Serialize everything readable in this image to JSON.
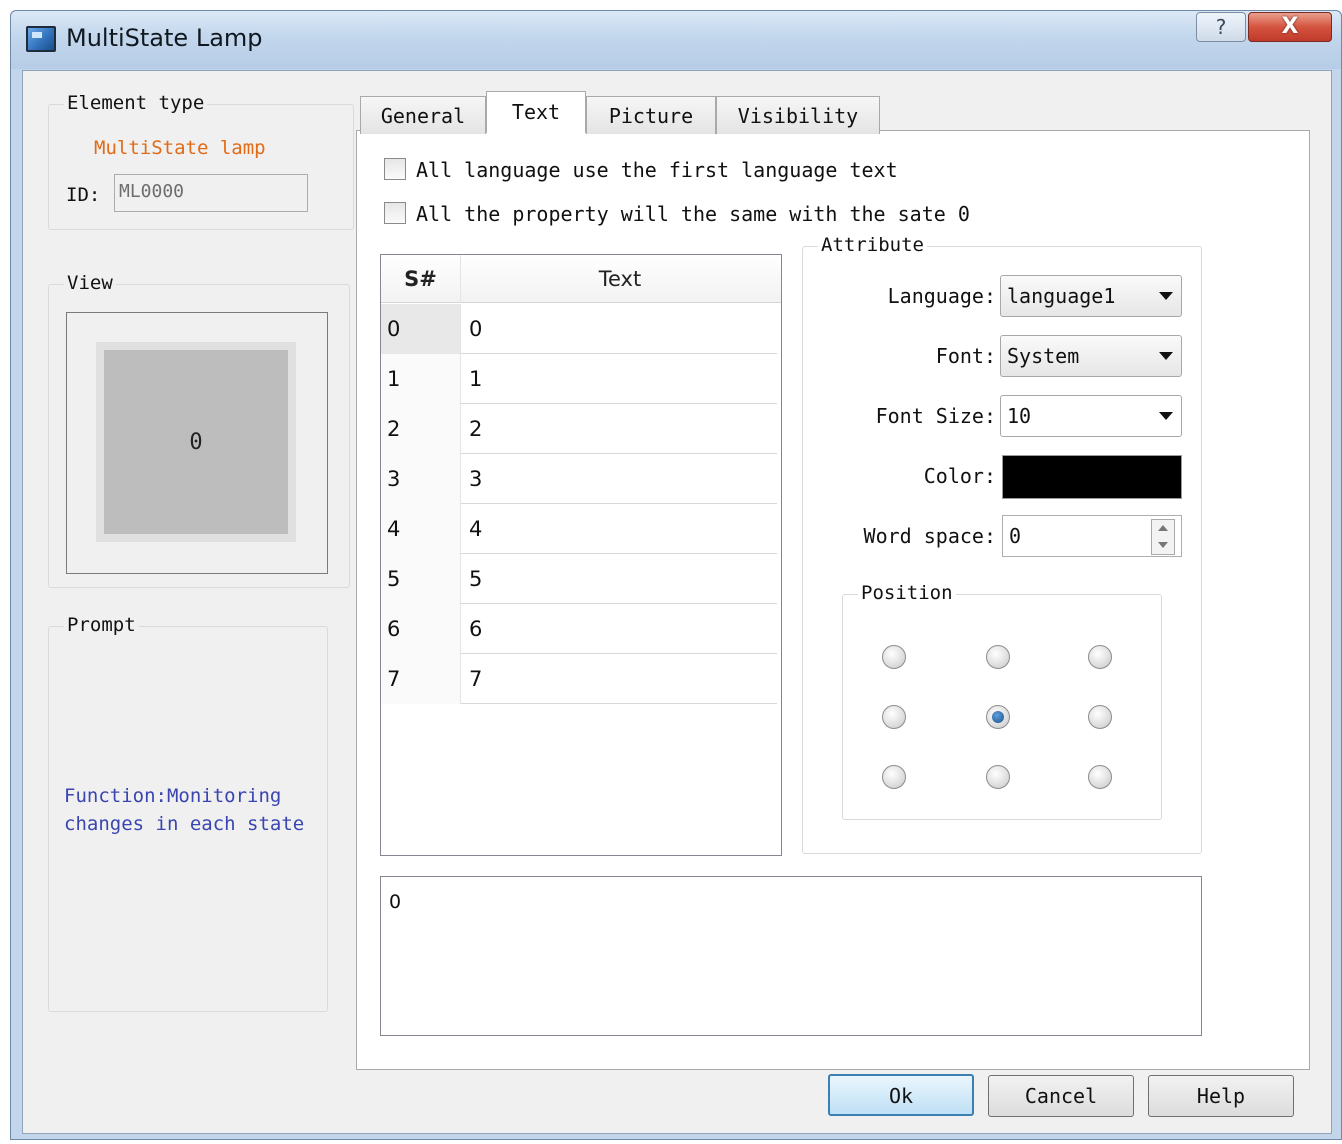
{
  "window": {
    "title": "MultiState Lamp",
    "help_symbol": "?",
    "close_symbol": "X"
  },
  "element_type": {
    "label": "Element type",
    "value": "MultiState lamp",
    "id_label": "ID:",
    "id_value": "ML0000"
  },
  "view": {
    "label": "View",
    "lamp_text": "0"
  },
  "prompt": {
    "label": "Prompt",
    "text": "Function:Monitoring changes in each state"
  },
  "tabs": [
    {
      "label": "General",
      "active": false
    },
    {
      "label": "Text",
      "active": true
    },
    {
      "label": "Picture",
      "active": false
    },
    {
      "label": "Visibility",
      "active": false
    }
  ],
  "options": {
    "first_language": "All language use the first language text",
    "same_property": "All the property will the same with the sate 0"
  },
  "table": {
    "columns": [
      "S#",
      "Text"
    ],
    "rows": [
      [
        "0",
        "0"
      ],
      [
        "1",
        "1"
      ],
      [
        "2",
        "2"
      ],
      [
        "3",
        "3"
      ],
      [
        "4",
        "4"
      ],
      [
        "5",
        "5"
      ],
      [
        "6",
        "6"
      ],
      [
        "7",
        "7"
      ]
    ]
  },
  "attribute": {
    "label": "Attribute",
    "language_label": "Language:",
    "language_value": "language1",
    "font_label": "Font:",
    "font_value": "System",
    "font_size_label": "Font Size:",
    "font_size_value": "10",
    "color_label": "Color:",
    "color_value": "#000000",
    "word_space_label": "Word space:",
    "word_space_value": "0"
  },
  "position": {
    "label": "Position",
    "selected": "middle-center"
  },
  "text_editor": {
    "value": "0"
  },
  "buttons": {
    "ok": "Ok",
    "cancel": "Cancel",
    "help": "Help"
  }
}
